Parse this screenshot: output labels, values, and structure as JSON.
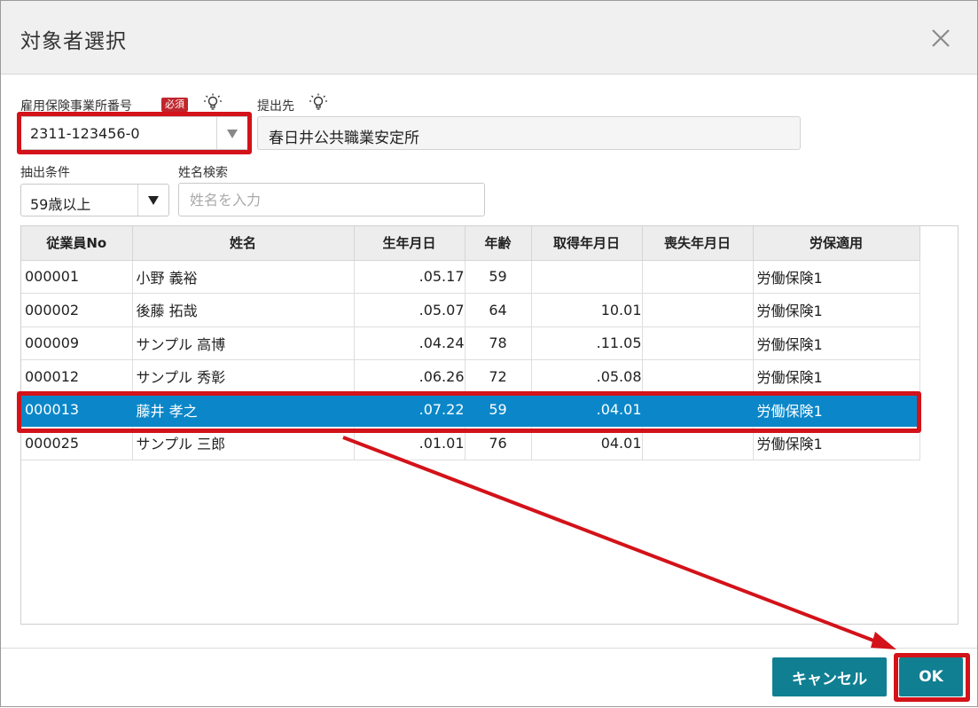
{
  "dialog": {
    "title": "対象者選択",
    "close_icon": "close-icon"
  },
  "office_number": {
    "label": "雇用保険事業所番号",
    "required_badge": "必須",
    "value": "2311-123456-0",
    "hint_icon": "lightbulb-icon"
  },
  "submit_to": {
    "label": "提出先",
    "value": "春日井公共職業安定所",
    "hint_icon": "lightbulb-icon"
  },
  "filter": {
    "label": "抽出条件",
    "value": "59歳以上"
  },
  "name_search": {
    "label": "姓名検索",
    "placeholder": "姓名を入力",
    "value": ""
  },
  "table": {
    "columns": [
      "従業員No",
      "姓名",
      "生年月日",
      "年齢",
      "取得年月日",
      "喪失年月日",
      "労保適用"
    ],
    "rows": [
      {
        "no": "000001",
        "name": "小野 義裕",
        "birth": ".05.17",
        "age": "59",
        "acquired": "",
        "lost": "",
        "insurance": "労働保険1",
        "selected": false
      },
      {
        "no": "000002",
        "name": "後藤 拓哉",
        "birth": ".05.07",
        "age": "64",
        "acquired": "10.01",
        "lost": "",
        "insurance": "労働保険1",
        "selected": false
      },
      {
        "no": "000009",
        "name": "サンプル 高博",
        "birth": ".04.24",
        "age": "78",
        "acquired": ".11.05",
        "lost": "",
        "insurance": "労働保険1",
        "selected": false
      },
      {
        "no": "000012",
        "name": "サンプル 秀彰",
        "birth": ".06.26",
        "age": "72",
        "acquired": ".05.08",
        "lost": "",
        "insurance": "労働保険1",
        "selected": false
      },
      {
        "no": "000013",
        "name": "藤井 孝之",
        "birth": ".07.22",
        "age": "59",
        "acquired": ".04.01",
        "lost": "",
        "insurance": "労働保険1",
        "selected": true
      },
      {
        "no": "000025",
        "name": "サンプル 三郎",
        "birth": ".01.01",
        "age": "76",
        "acquired": "04.01",
        "lost": "",
        "insurance": "労働保険1",
        "selected": false
      }
    ]
  },
  "buttons": {
    "cancel": "キャンセル",
    "ok": "OK"
  },
  "colors": {
    "selected_row": "#0b87c9",
    "button": "#107f92",
    "highlight": "#d31219",
    "required_badge": "#c0262d"
  }
}
